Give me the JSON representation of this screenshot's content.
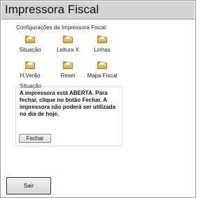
{
  "window": {
    "title": "Impressora Fiscal"
  },
  "config": {
    "label": "Configurações da Impressora Fiscal:",
    "items": [
      {
        "label": "Situação",
        "icon": "folder-icon"
      },
      {
        "label": "Leitura X",
        "icon": "folder-icon"
      },
      {
        "label": "Linhas",
        "icon": "folder-icon"
      },
      {
        "label": "H.Verão",
        "icon": "folder-icon"
      },
      {
        "label": "Reset",
        "icon": "folder-icon"
      },
      {
        "label": "Mapa Fiscal",
        "icon": "folder-icon"
      }
    ]
  },
  "situacao": {
    "legend": "Situação",
    "message": "A impressora está ABERTA. Para fechar, clique no botão Fechar. A impressora não poderá ser utilizada no dia de hoje.",
    "fechar_label": "Fechar"
  },
  "footer": {
    "sair_label": "Sair"
  },
  "colors": {
    "title_bar": "#d4d4d4",
    "folder": "#e8b83c",
    "background": "#ffffff"
  }
}
